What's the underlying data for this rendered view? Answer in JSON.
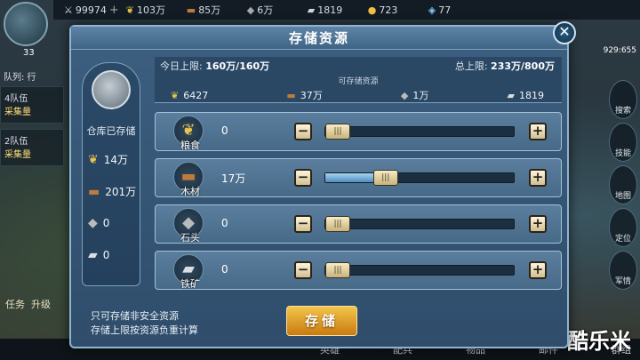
{
  "hud": {
    "level": "33",
    "top_resources": [
      {
        "icon": "sword-icon",
        "value": "99974"
      },
      {
        "icon": "grain-icon",
        "value": "103万"
      },
      {
        "icon": "wood-icon",
        "value": "85万"
      },
      {
        "icon": "stone-icon",
        "value": "6万"
      },
      {
        "icon": "iron-icon",
        "value": "1819"
      },
      {
        "icon": "gold-icon",
        "value": "723"
      },
      {
        "icon": "gem-icon",
        "value": "77"
      }
    ],
    "queue_label": "队列: 行",
    "troops": [
      {
        "tag": "4队伍",
        "status": "采集量"
      },
      {
        "tag": "2队伍",
        "status": "采集量"
      }
    ],
    "task_label": "任务",
    "upgrade_label": "升级",
    "right_buttons": [
      "搜索",
      "技能",
      "地图",
      "定位",
      "军情"
    ],
    "map_coords": "929:655",
    "bottom_tabs": [
      "英雄",
      "配兵",
      "物品",
      "邮件",
      "群组"
    ],
    "watermark": "酷乐米"
  },
  "dialog": {
    "title": "存储资源",
    "close_icon": "close-icon",
    "today_limit_label": "今日上限:",
    "today_limit_value": "160万/160万",
    "total_limit_label": "总上限:",
    "total_limit_value": "233万/800万",
    "storable_caption": "可存储资源",
    "storable": [
      {
        "icon": "grain-icon",
        "value": "6427"
      },
      {
        "icon": "wood-icon",
        "value": "37万"
      },
      {
        "icon": "stone-icon",
        "value": "1万"
      },
      {
        "icon": "iron-icon",
        "value": "1819"
      }
    ],
    "stored_label": "仓库已存储",
    "stored": [
      {
        "icon": "grain-icon",
        "value": "14万"
      },
      {
        "icon": "wood-icon",
        "value": "201万"
      },
      {
        "icon": "stone-icon",
        "value": "0"
      },
      {
        "icon": "iron-icon",
        "value": "0"
      }
    ],
    "rows": [
      {
        "name": "粮食",
        "icon": "grain-icon",
        "amount": "0",
        "fill": 0.0
      },
      {
        "name": "木材",
        "icon": "wood-icon",
        "amount": "17万",
        "fill": 0.32
      },
      {
        "name": "石头",
        "icon": "stone-icon",
        "amount": "0",
        "fill": 0.0
      },
      {
        "name": "铁矿",
        "icon": "iron-icon",
        "amount": "0",
        "fill": 0.0
      }
    ],
    "minus_label": "−",
    "plus_label": "+",
    "thumb_label": "|||",
    "note_line1": "只可存储非安全资源",
    "note_line2": "存储上限按资源负重计算",
    "store_button": "存储"
  },
  "colors": {
    "dialog_bg": "#3d5f80",
    "store_button": "#e9a52c",
    "slider_fill": "#7fb8de"
  }
}
